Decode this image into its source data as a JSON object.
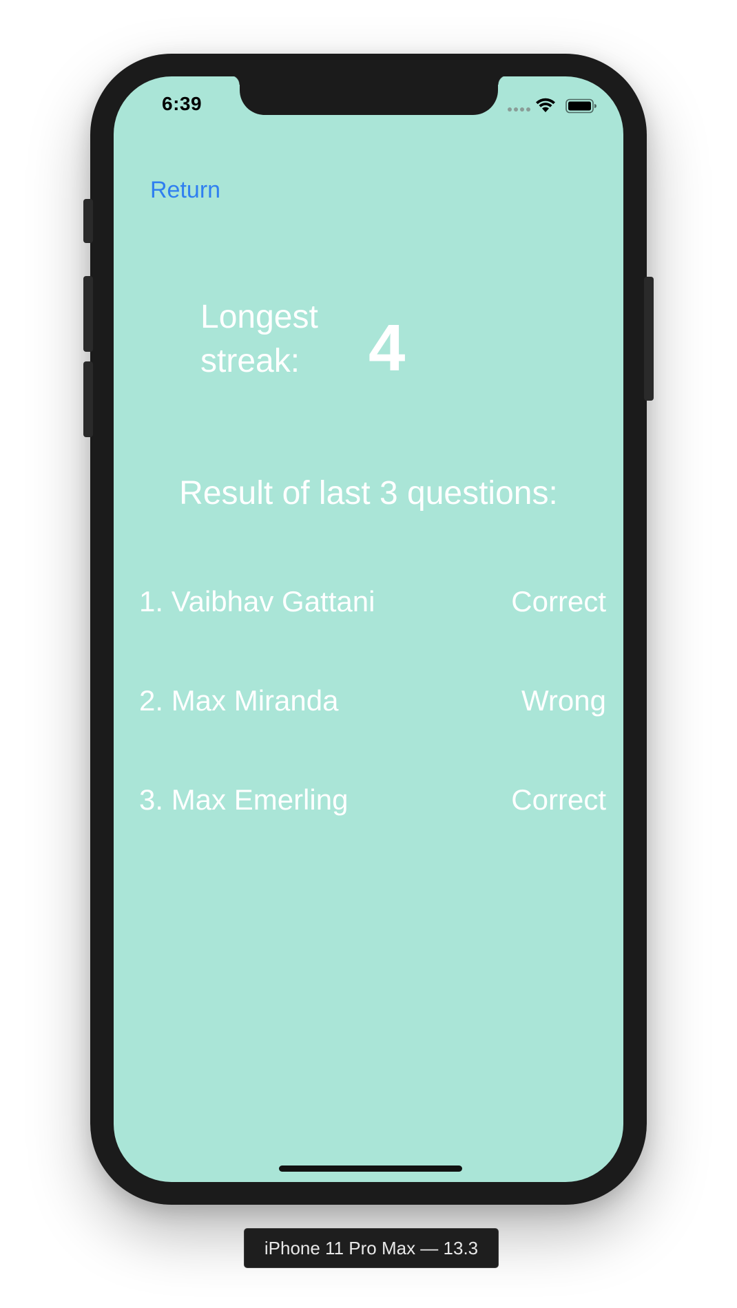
{
  "status_bar": {
    "time": "6:39"
  },
  "nav": {
    "return_label": "Return"
  },
  "streak": {
    "label": "Longest streak:",
    "value": "4"
  },
  "results": {
    "heading": "Result of last 3 questions:",
    "items": [
      {
        "name": "1. Vaibhav Gattani",
        "result": "Correct"
      },
      {
        "name": "2. Max Miranda",
        "result": "Wrong"
      },
      {
        "name": "3. Max Emerling",
        "result": "Correct"
      }
    ]
  },
  "device_label": "iPhone 11 Pro Max — 13.3",
  "colors": {
    "screen_background": "#aae5d7",
    "link": "#2f7ff0",
    "text": "#ffffff",
    "device_frame": "#1b1b1b"
  },
  "icons": [
    "wifi-icon",
    "battery-icon",
    "cellular-signal-icon"
  ]
}
